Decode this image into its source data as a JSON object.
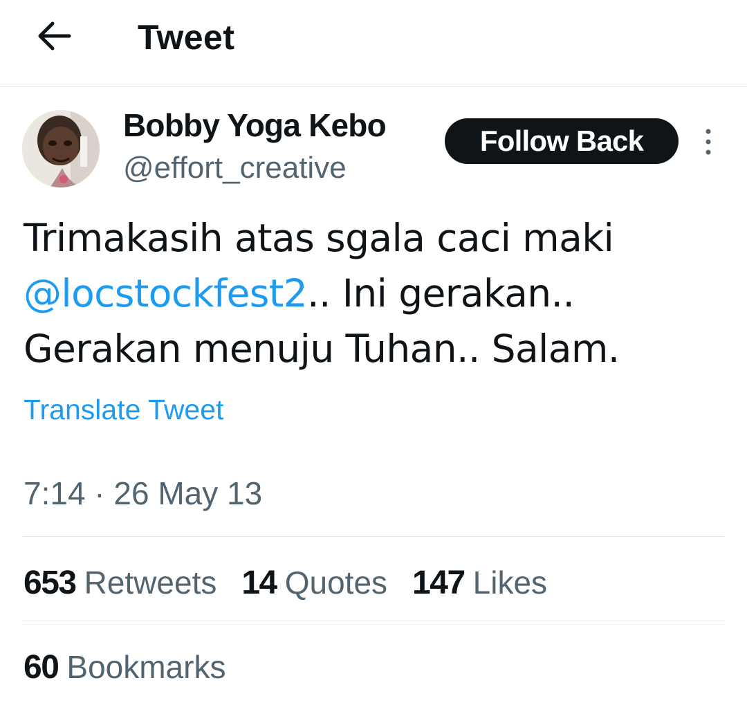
{
  "header": {
    "back_icon": "arrow-left-icon",
    "title": "Tweet"
  },
  "author": {
    "display_name": "Bobby Yoga Kebo",
    "handle": "@effort_creative",
    "follow_label": "Follow Back",
    "more_icon": "more-vertical-icon"
  },
  "tweet": {
    "line1": "Trimakasih atas sgala caci maki",
    "mention": "@locstockfest2",
    "line2_rest": ".. Ini gerakan..",
    "line3": "Gerakan menuju Tuhan.. Salam.",
    "translate_label": "Translate Tweet",
    "timestamp": "7:14 · 26 May 13"
  },
  "stats": {
    "retweets_count": "653",
    "retweets_label": "Retweets",
    "quotes_count": "14",
    "quotes_label": "Quotes",
    "likes_count": "147",
    "likes_label": "Likes",
    "bookmarks_count": "60",
    "bookmarks_label": "Bookmarks"
  },
  "colors": {
    "text": "#0f1419",
    "secondary_text": "#536471",
    "link": "#1d9bf0",
    "divider": "#e1e8ed",
    "button_bg": "#0f1419"
  }
}
